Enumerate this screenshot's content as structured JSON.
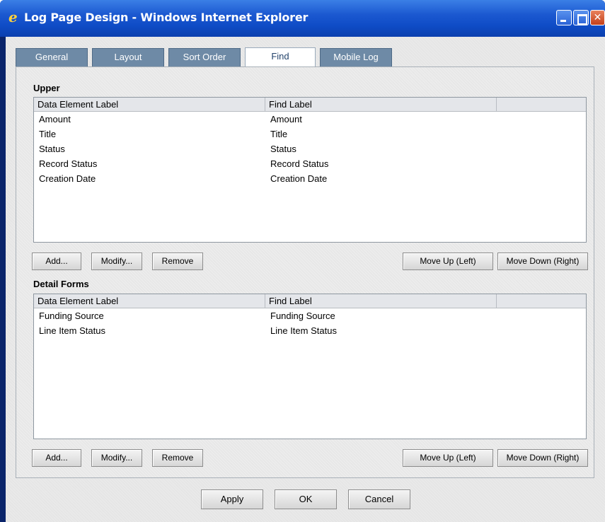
{
  "window": {
    "title": "Log Page Design - Windows Internet Explorer",
    "close_glyph": "✕"
  },
  "tabs": [
    "General",
    "Layout",
    "Sort Order",
    "Find",
    "Mobile Log"
  ],
  "active_tab": "Find",
  "upper": {
    "label": "Upper",
    "columns": [
      "Data Element Label",
      "Find Label",
      ""
    ],
    "rows": [
      [
        "Amount",
        "Amount"
      ],
      [
        "Title",
        "Title"
      ],
      [
        "Status",
        "Status"
      ],
      [
        "Record Status",
        "Record Status"
      ],
      [
        "Creation Date",
        "Creation Date"
      ]
    ],
    "buttons": {
      "add": "Add...",
      "modify": "Modify...",
      "remove": "Remove",
      "move_up": "Move Up (Left)",
      "move_down": "Move Down (Right)"
    }
  },
  "detail": {
    "label": "Detail Forms",
    "columns": [
      "Data Element Label",
      "Find Label",
      ""
    ],
    "rows": [
      [
        "Funding Source",
        "Funding Source"
      ],
      [
        "Line Item Status",
        "Line Item Status"
      ]
    ],
    "buttons": {
      "add": "Add...",
      "modify": "Modify...",
      "remove": "Remove",
      "move_up": "Move Up (Left)",
      "move_down": "Move Down (Right)"
    }
  },
  "footer": {
    "apply": "Apply",
    "ok": "OK",
    "cancel": "Cancel"
  }
}
